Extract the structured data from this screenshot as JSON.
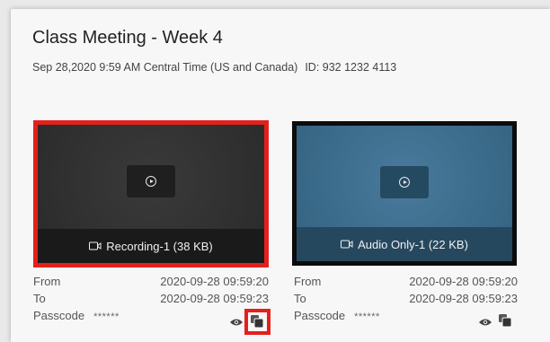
{
  "meeting": {
    "title": "Class Meeting - Week 4",
    "datetime": "Sep 28,2020 9:59 AM Central Time (US and Canada)",
    "id_text": "ID: 932 1232 4113"
  },
  "recordings": [
    {
      "caption": "Recording-1 (38 KB)",
      "from_label": "From",
      "from_value": "2020-09-28 09:59:20",
      "to_label": "To",
      "to_value": "2020-09-28 09:59:23",
      "passcode_label": "Passcode",
      "passcode_value": "******",
      "highlight_color": "#e4201b"
    },
    {
      "caption": "Audio Only-1 (22 KB)",
      "from_label": "From",
      "from_value": "2020-09-28 09:59:20",
      "to_label": "To",
      "to_value": "2020-09-28 09:59:23",
      "passcode_label": "Passcode",
      "passcode_value": "******"
    }
  ],
  "icons": [
    "play-icon",
    "video-camera-icon",
    "eye-icon",
    "copy-icon"
  ],
  "colors": {
    "highlight": "#e4201b",
    "audio_tile": "#3d6b8d",
    "video_tile": "#2e2e2e"
  }
}
